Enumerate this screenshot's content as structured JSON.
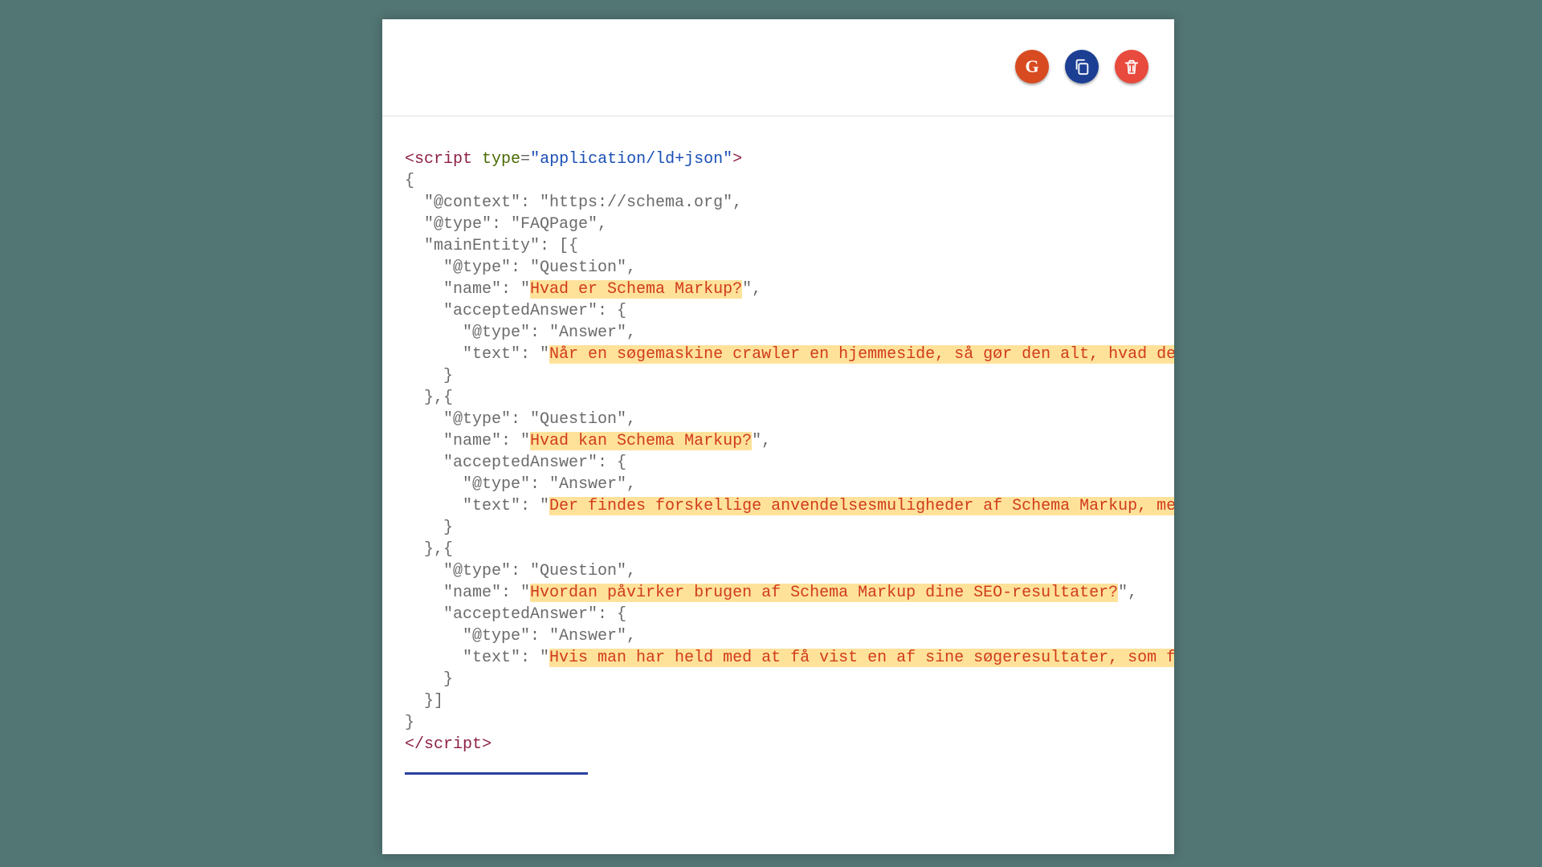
{
  "toolbar": {
    "google_letter": "G"
  },
  "code": {
    "tag_open": "<script",
    "space": " ",
    "type_attr": "type",
    "eq": "=",
    "type_val": "\"application/ld+json\"",
    "tag_open_end": ">",
    "l1": "{",
    "l2": "  \"@context\": \"https://schema.org\",",
    "l3": "  \"@type\": \"FAQPage\",",
    "l4": "  \"mainEntity\": [{",
    "l5": "    \"@type\": \"Question\",",
    "l6a": "    \"name\": \"",
    "l6h": "Hvad er Schema Markup?",
    "l6b": "\",",
    "l7": "    \"acceptedAnswer\": {",
    "l8": "      \"@type\": \"Answer\",",
    "l9a": "      \"text\": \"",
    "l9h": "Når en søgemaskine crawler en hjemmeside, så gør den alt, hvad den kan for",
    "l10": "    }",
    "l11": "  },{",
    "l12": "    \"@type\": \"Question\",",
    "l13a": "    \"name\": \"",
    "l13h": "Hvad kan Schema Markup?",
    "l13b": "\",",
    "l14": "    \"acceptedAnswer\": {",
    "l15": "      \"@type\": \"Answer\",",
    "l16a": "      \"text\": \"",
    "l16h": "Der findes forskellige anvendelsesmuligheder af Schema Markup, men fælles ",
    "l17": "    }",
    "l18": "  },{",
    "l19": "    \"@type\": \"Question\",",
    "l20a": "    \"name\": \"",
    "l20h": "Hvordan påvirker brugen af Schema Markup dine SEO-resultater?",
    "l20b": "\",",
    "l21": "    \"acceptedAnswer\": {",
    "l22": "      \"@type\": \"Answer\",",
    "l23a": "      \"text\": \"",
    "l23h": "Hvis man har held med at få vist en af sine søgeresultater, som f.eks. en ",
    "l24": "    }",
    "l25": "  }]",
    "l26": "}",
    "tag_close": "</script>"
  }
}
